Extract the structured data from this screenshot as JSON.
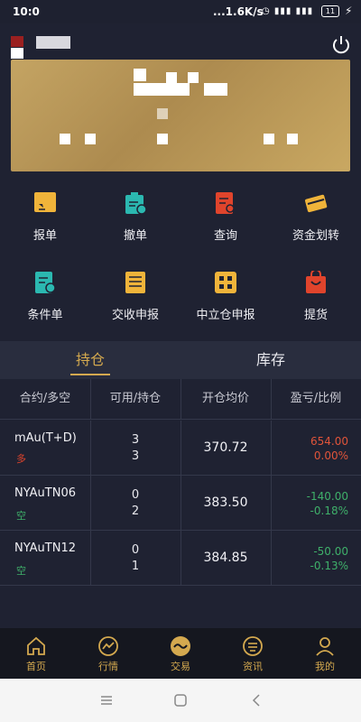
{
  "status_bar": {
    "time": "10:0",
    "net_speed": "...1.6K/s",
    "signal": "4G 3G",
    "battery": "11"
  },
  "menu": [
    {
      "label": "报单",
      "icon": "order-icon",
      "color": "#f0b43a"
    },
    {
      "label": "撤单",
      "icon": "cancel-order-icon",
      "color": "#2bb8b0"
    },
    {
      "label": "查询",
      "icon": "query-icon",
      "color": "#e0442c"
    },
    {
      "label": "资金划转",
      "icon": "fund-transfer-icon",
      "color": "#f0b43a"
    },
    {
      "label": "条件单",
      "icon": "conditional-order-icon",
      "color": "#2bb8b0"
    },
    {
      "label": "交收申报",
      "icon": "delivery-declare-icon",
      "color": "#f0b43a"
    },
    {
      "label": "中立仓申报",
      "icon": "neutral-position-icon",
      "color": "#f0b43a"
    },
    {
      "label": "提货",
      "icon": "pickup-icon",
      "color": "#e0442c"
    }
  ],
  "tabs": [
    {
      "label": "持仓",
      "active": true
    },
    {
      "label": "库存",
      "active": false
    }
  ],
  "table": {
    "headers": [
      "合约/多空",
      "可用/持仓",
      "开仓均价",
      "盈亏/比例"
    ],
    "rows": [
      {
        "name": "mAu(T+D)",
        "dir": "多",
        "dir_color": "#e0442c",
        "available": "3",
        "holding": "3",
        "price": "370.72",
        "pl": "654.00",
        "ratio": "0.00%",
        "pl_color": "#e0543a"
      },
      {
        "name": "NYAuTN06",
        "dir": "空",
        "dir_color": "#3fb06a",
        "available": "0",
        "holding": "2",
        "price": "383.50",
        "pl": "-140.00",
        "ratio": "-0.18%",
        "pl_color": "#3fb06a"
      },
      {
        "name": "NYAuTN12",
        "dir": "空",
        "dir_color": "#3fb06a",
        "available": "0",
        "holding": "1",
        "price": "384.85",
        "pl": "-50.00",
        "ratio": "-0.13%",
        "pl_color": "#3fb06a"
      }
    ]
  },
  "bottom_nav": [
    {
      "label": "首页",
      "icon": "home-icon"
    },
    {
      "label": "行情",
      "icon": "market-icon"
    },
    {
      "label": "交易",
      "icon": "trade-icon"
    },
    {
      "label": "资讯",
      "icon": "news-icon"
    },
    {
      "label": "我的",
      "icon": "profile-icon"
    }
  ],
  "colors": {
    "accent": "#d4a94f",
    "background": "#1f2232",
    "card": "#c4a463"
  }
}
